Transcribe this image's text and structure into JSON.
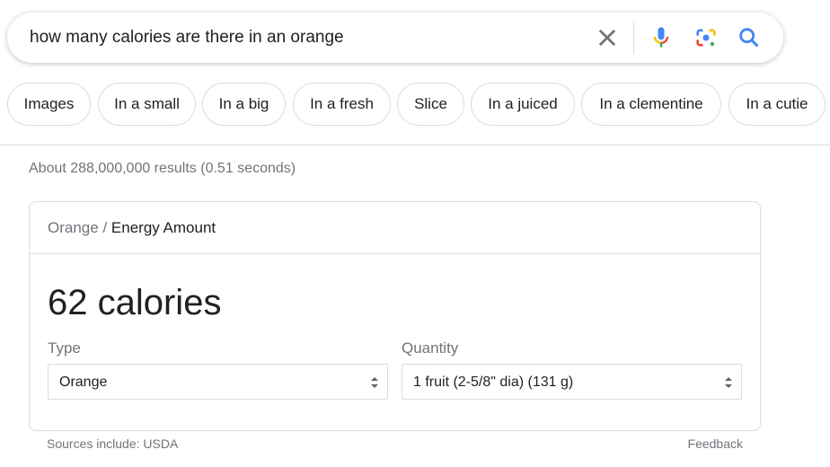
{
  "search": {
    "query": "how many calories are there in an orange",
    "icons": [
      "close-icon",
      "microphone-icon",
      "google-lens-icon",
      "search-icon"
    ]
  },
  "chips": [
    "Images",
    "In a small",
    "In a big",
    "In a fresh",
    "Slice",
    "In a juiced",
    "In a clementine",
    "In a cutie"
  ],
  "results_stats": "About 288,000,000 results (0.51 seconds)",
  "card": {
    "breadcrumb": {
      "parent": "Orange",
      "sep": "/",
      "current": "Energy Amount"
    },
    "value": "62 calories",
    "type_label": "Type",
    "type_value": "Orange",
    "quantity_label": "Quantity",
    "quantity_value": "1 fruit (2-5/8\" dia) (131 g)"
  },
  "footer": {
    "sources": "Sources include: USDA",
    "feedback": "Feedback"
  }
}
